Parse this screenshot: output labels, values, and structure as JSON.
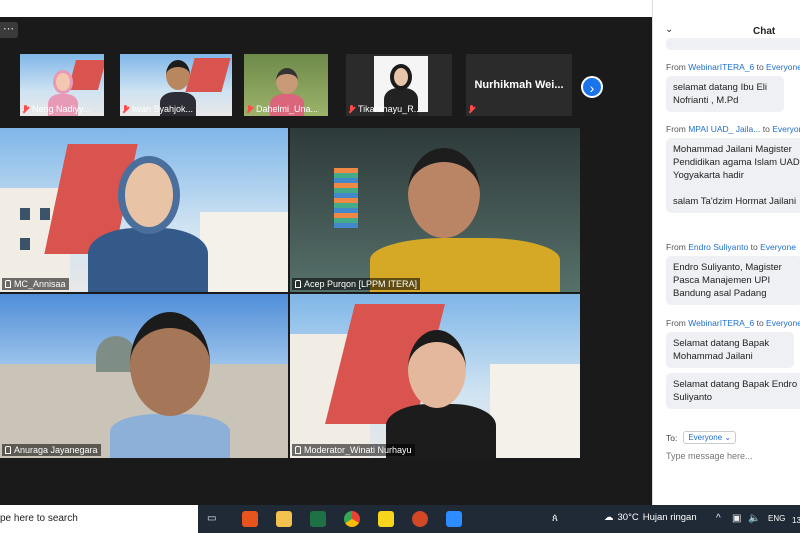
{
  "thumbnails": [
    {
      "name": "Neng Nadiyy..."
    },
    {
      "name": "Iwan Syahjok..."
    },
    {
      "name": "Dahelmi_Una..."
    },
    {
      "name": "Tikarahayu_R..."
    },
    {
      "name": "Nurhikmah Wei..."
    }
  ],
  "tiles": [
    {
      "name": "MC_Annisaa"
    },
    {
      "name": "Acep Purqon [LPPM ITERA]"
    },
    {
      "name": "Anuraga Jayanegara"
    },
    {
      "name": "Moderator_Winati Nurhayu"
    }
  ],
  "chat": {
    "title": "Chat",
    "messages": [
      {
        "from": "WebinarITERA_6",
        "to_word": "to",
        "to": "Everyone",
        "text": "selamat datang Ibu Eli Nofrianti , M.Pd"
      },
      {
        "from": "MPAI UAD_ Jaila...",
        "to_word": "to",
        "to": "Everyone",
        "text": "Mohammad Jailani Magister Pendidikan agama Islam UAD Yogyakarta hadir\n\nsalam Ta'dzim Hormat Jailani"
      },
      {
        "from": "Endro Suliyanto",
        "to_word": "to",
        "to": "Everyone",
        "text": "Endro Suliyanto, Magister Pasca Manajemen UPI Bandung asal Padang"
      },
      {
        "from": "WebinarITERA_6",
        "to_word": "to",
        "to": "Everyone",
        "text": "Selamat datang Bapak Mohammad Jailani"
      },
      {
        "from": "",
        "to_word": "",
        "to": "",
        "text": "Selamat datang Bapak Endro Suliyanto"
      }
    ],
    "from_label": "From",
    "to_label": "To:",
    "to_value": "Everyone",
    "input_placeholder": "Type message here..."
  },
  "taskbar": {
    "search_text": "pe here to search",
    "temperature": "30°C",
    "weather": "Hujan ringan",
    "language": "ENG",
    "time": "13"
  },
  "colors": {
    "accent": "#1a73e8",
    "active_speaker": "#c8d64a",
    "mute": "#ff4a4a",
    "chat_user": "#1f6fd1"
  }
}
